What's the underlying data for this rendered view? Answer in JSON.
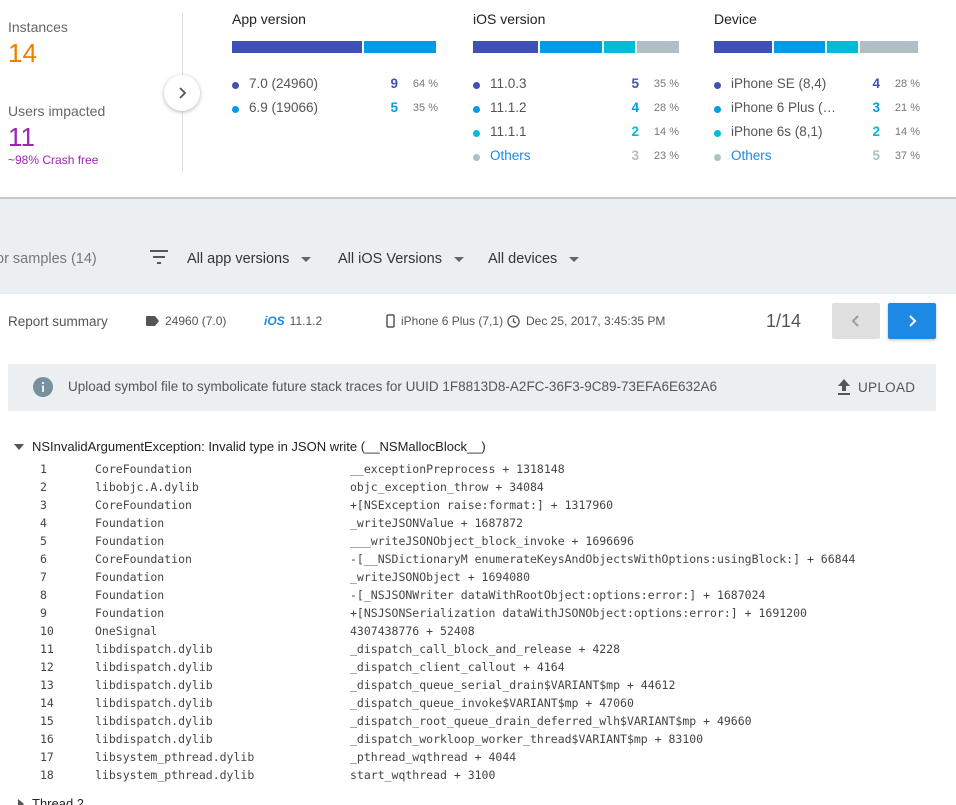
{
  "stats": {
    "instances_label": "Instances",
    "instances_value": "14",
    "users_label": "Users impacted",
    "users_value": "11",
    "crash_free": "~98% Crash free"
  },
  "app_version": {
    "title": "App version",
    "rows": [
      {
        "name": "7.0 (24960)",
        "count": "9",
        "pct": "64 %",
        "color": "#3f51b5"
      },
      {
        "name": "6.9 (19066)",
        "count": "5",
        "pct": "35 %",
        "color": "#039be5"
      }
    ]
  },
  "ios_version": {
    "title": "iOS version",
    "rows": [
      {
        "name": "11.0.3",
        "count": "5",
        "pct": "35 %",
        "color": "#3f51b5"
      },
      {
        "name": "11.1.2",
        "count": "4",
        "pct": "28 %",
        "color": "#039be5"
      },
      {
        "name": "11.1.1",
        "count": "2",
        "pct": "14 %",
        "color": "#00bcd4"
      },
      {
        "name": "Others",
        "count": "3",
        "pct": "23 %",
        "color": "#b0bec5"
      }
    ]
  },
  "device": {
    "title": "Device",
    "rows": [
      {
        "name": "iPhone SE (8,4)",
        "count": "4",
        "pct": "28 %",
        "color": "#3f51b5"
      },
      {
        "name": "iPhone 6 Plus (…",
        "count": "3",
        "pct": "21 %",
        "color": "#039be5"
      },
      {
        "name": "iPhone 6s (8,1)",
        "count": "2",
        "pct": "14 %",
        "color": "#00bcd4"
      },
      {
        "name": "Others",
        "count": "5",
        "pct": "37 %",
        "color": "#b0bec5"
      }
    ]
  },
  "filters": {
    "samples": "or samples (14)",
    "app_versions": "All app versions",
    "ios_versions": "All iOS Versions",
    "devices": "All devices"
  },
  "report": {
    "summary_label": "Report summary",
    "build": "24960 (7.0)",
    "ios_badge": "iOS",
    "ios": "11.1.2",
    "device": "iPhone 6 Plus (7,1)",
    "date": "Dec 25, 2017, 3:45:35 PM",
    "pager": "1/14",
    "notice": "Upload symbol file to symbolicate future stack traces for UUID 1F8813D8-A2FC-36F3-9C89-73EFA6E632A6",
    "upload_label": "UPLOAD",
    "exception": "NSInvalidArgumentException: Invalid type in JSON write (__NSMallocBlock__)",
    "thread2": "Thread 2"
  },
  "frames": [
    {
      "n": "1",
      "lib": "CoreFoundation",
      "sym": "__exceptionPreprocess + 1318148"
    },
    {
      "n": "2",
      "lib": "libobjc.A.dylib",
      "sym": "objc_exception_throw + 34084"
    },
    {
      "n": "3",
      "lib": "CoreFoundation",
      "sym": "+[NSException raise:format:] + 1317960"
    },
    {
      "n": "4",
      "lib": "Foundation",
      "sym": "_writeJSONValue + 1687872"
    },
    {
      "n": "5",
      "lib": "Foundation",
      "sym": "___writeJSONObject_block_invoke + 1696696"
    },
    {
      "n": "6",
      "lib": "CoreFoundation",
      "sym": "-[__NSDictionaryM enumerateKeysAndObjectsWithOptions:usingBlock:] + 66844"
    },
    {
      "n": "7",
      "lib": "Foundation",
      "sym": "_writeJSONObject + 1694080"
    },
    {
      "n": "8",
      "lib": "Foundation",
      "sym": "-[_NSJSONWriter dataWithRootObject:options:error:] + 1687024"
    },
    {
      "n": "9",
      "lib": "Foundation",
      "sym": "+[NSJSONSerialization dataWithJSONObject:options:error:] + 1691200"
    },
    {
      "n": "10",
      "lib": "OneSignal",
      "sym": "4307438776 + 52408"
    },
    {
      "n": "11",
      "lib": "libdispatch.dylib",
      "sym": "_dispatch_call_block_and_release + 4228"
    },
    {
      "n": "12",
      "lib": "libdispatch.dylib",
      "sym": "_dispatch_client_callout + 4164"
    },
    {
      "n": "13",
      "lib": "libdispatch.dylib",
      "sym": "_dispatch_queue_serial_drain$VARIANT$mp + 44612"
    },
    {
      "n": "14",
      "lib": "libdispatch.dylib",
      "sym": "_dispatch_queue_invoke$VARIANT$mp + 47060"
    },
    {
      "n": "15",
      "lib": "libdispatch.dylib",
      "sym": "_dispatch_root_queue_drain_deferred_wlh$VARIANT$mp + 49660"
    },
    {
      "n": "16",
      "lib": "libdispatch.dylib",
      "sym": "_dispatch_workloop_worker_thread$VARIANT$mp + 83100"
    },
    {
      "n": "17",
      "lib": "libsystem_pthread.dylib",
      "sym": "_pthread_wqthread + 4044"
    },
    {
      "n": "18",
      "lib": "libsystem_pthread.dylib",
      "sym": "start_wqthread + 3100"
    }
  ]
}
